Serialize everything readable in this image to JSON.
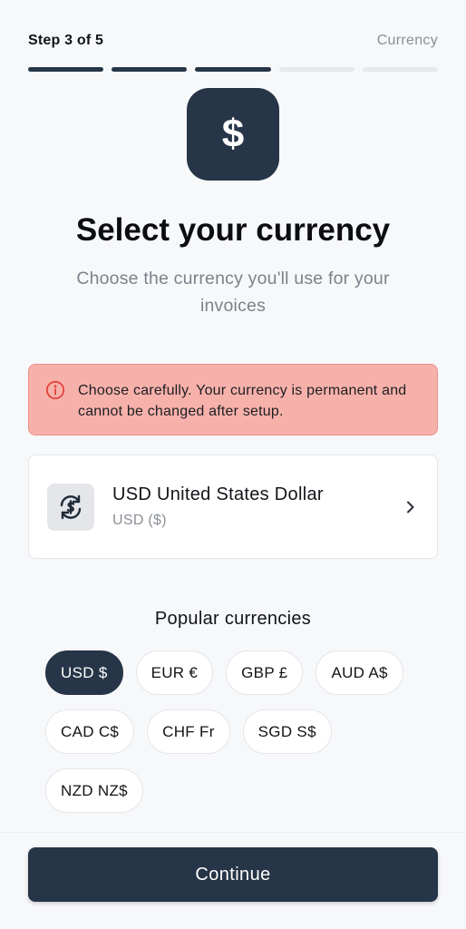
{
  "header": {
    "step_label": "Step 3 of 5",
    "step_name": "Currency",
    "total_steps": 5,
    "completed_steps": 3
  },
  "hero": {
    "icon": "dollar-sign-icon",
    "glyph": "$"
  },
  "title": "Select your currency",
  "subtitle": "Choose the currency you'll use for your invoices",
  "warning": {
    "icon": "info-circle-icon",
    "text": "Choose carefully. Your currency is permanent and cannot be changed after setup."
  },
  "selected_currency": {
    "icon": "currency-exchange-icon",
    "name": "USD United States Dollar",
    "code": "USD ($)"
  },
  "popular": {
    "title": "Popular currencies",
    "items": [
      {
        "label": "USD $",
        "active": true
      },
      {
        "label": "EUR €",
        "active": false
      },
      {
        "label": "GBP £",
        "active": false
      },
      {
        "label": "AUD A$",
        "active": false
      },
      {
        "label": "CAD C$",
        "active": false
      },
      {
        "label": "CHF Fr",
        "active": false
      },
      {
        "label": "SGD S$",
        "active": false
      },
      {
        "label": "NZD NZ$",
        "active": false
      }
    ]
  },
  "footer": {
    "continue_label": "Continue"
  },
  "colors": {
    "primary": "#263547",
    "warning_bg": "#f7b1ab",
    "warning_border": "#ef8f88",
    "warning_icon": "#e0453c",
    "muted_text": "#8a8f96",
    "background": "#f7f8fa"
  }
}
